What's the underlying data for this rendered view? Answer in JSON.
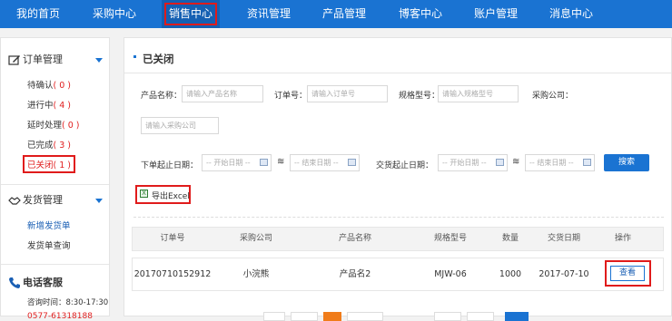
{
  "nav": {
    "items": [
      "我的首页",
      "采购中心",
      "销售中心",
      "资讯管理",
      "产品管理",
      "博客中心",
      "账户管理",
      "消息中心"
    ],
    "active": "销售中心"
  },
  "sidebar": {
    "order_section": {
      "title": "订单管理",
      "items": [
        {
          "label": "待确认",
          "count": "( 0 )"
        },
        {
          "label": "进行中",
          "count": "( 4 )"
        },
        {
          "label": "延时处理",
          "count": "( 0 )"
        },
        {
          "label": "已完成",
          "count": "( 3 )"
        },
        {
          "label": "已关闭",
          "count": "( 1 )"
        }
      ]
    },
    "shipping_section": {
      "title": "发货管理",
      "items": [
        "新增发货单",
        "发货单查询"
      ]
    },
    "contact": {
      "title": "电话客服",
      "hours": "咨询时间：8:30-17:30",
      "phone": "0577-61318188"
    }
  },
  "page": {
    "title": "已关闭"
  },
  "filters": {
    "product_name": {
      "label": "产品名称：",
      "placeholder": "请输入产品名称"
    },
    "order_no": {
      "label": "订单号：",
      "placeholder": "请输入订单号"
    },
    "spec_model": {
      "label": "规格型号：",
      "placeholder": "请输入规格型号"
    },
    "company": {
      "label": "采购公司：",
      "placeholder": "请输入采购公司"
    },
    "order_date": {
      "label": "下单起止日期：",
      "start": "-- 开始日期 --",
      "end": "-- 结束日期 --"
    },
    "delivery_date": {
      "label": "交货起止日期：",
      "start": "-- 开始日期 --",
      "end": "-- 结束日期 --"
    },
    "search_label": "搜索",
    "export_label": "导出Excel"
  },
  "table": {
    "headers": [
      "订单号",
      "采购公司",
      "产品名称",
      "规格型号",
      "数量",
      "交货日期",
      "操作"
    ],
    "rows": [
      {
        "order_no": "20170710152912",
        "company": "小浣熊",
        "product": "产品名2",
        "spec": "MJW-06",
        "qty": "1000",
        "date": "2017-07-10",
        "action": "查看"
      }
    ]
  },
  "colors": {
    "nav_bg": "#1a73d2",
    "highlight": "#e01b1b",
    "count": "#e02020"
  }
}
